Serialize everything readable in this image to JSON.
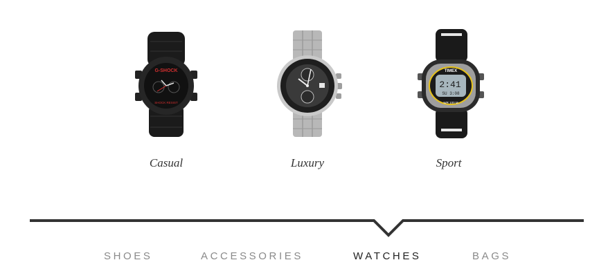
{
  "products": [
    {
      "label": "Casual",
      "icon": "gshock-watch-image"
    },
    {
      "label": "Luxury",
      "icon": "chronograph-watch-image"
    },
    {
      "label": "Sport",
      "icon": "digital-watch-image"
    }
  ],
  "watch_texts": {
    "gshock_brand": "G-SHOCK",
    "gshock_sub": "SHOCK RESIST",
    "timex_brand": "TIMEX",
    "timex_time": "2:41",
    "timex_date": "SU 3:08",
    "timex_wr": "WR 100 M"
  },
  "nav": {
    "active_index": 2,
    "items": [
      {
        "label": "SHOES"
      },
      {
        "label": "ACCESSORIES"
      },
      {
        "label": "WATCHES"
      },
      {
        "label": "BAGS"
      }
    ]
  },
  "colors": {
    "divider": "#333333",
    "nav_inactive": "#8a8a8a",
    "nav_active": "#222222",
    "caption": "#333333"
  }
}
